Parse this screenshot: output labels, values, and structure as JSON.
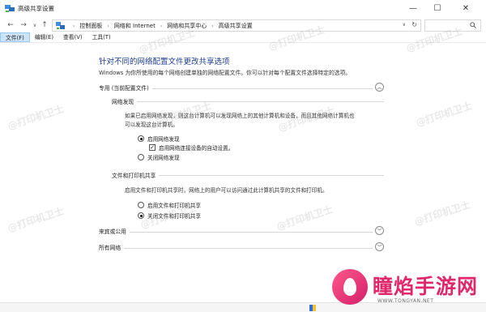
{
  "window": {
    "title": "高级共享设置",
    "minimize": "—",
    "maximize": "☐",
    "close": "✕"
  },
  "nav": {
    "back": "←",
    "forward": "→",
    "recent": "∨",
    "up": "↑"
  },
  "address": {
    "crumbs": [
      "控制面板",
      "网络和 Internet",
      "网络和共享中心",
      "高级共享设置"
    ],
    "separator": "›",
    "dropdown": "∨",
    "refresh": "↻"
  },
  "menu": {
    "items": [
      {
        "label": "文件(F)"
      },
      {
        "label": "编辑(E)"
      },
      {
        "label": "查看(V)"
      },
      {
        "label": "工具(T)"
      }
    ]
  },
  "page": {
    "heading": "针对不同的网络配置文件更改共享选项",
    "subtitle": "Windows 为你所使用的每个网络创建单独的网络配置文件。你可以针对每个配置文件选择特定的选项。"
  },
  "profiles": {
    "private_label": "专用 (当前配置文件)",
    "private_chevron": "︿",
    "guest_label": "来宾或公用",
    "guest_chevron": "﹀",
    "all_label": "所有网络",
    "all_chevron": "﹀"
  },
  "discovery": {
    "heading": "网络发现",
    "desc_line1": "如果已启用网络发现，则这台计算机可以发现网络上的其他计算机和设备，而且其他网络计算机也",
    "desc_line2": "可以发现这台计算机。",
    "on_label": "启用网络发现",
    "on_selected": true,
    "auto_label": "启用网络连接设备的自动设置。",
    "auto_checked": true,
    "check_mark": "✓",
    "off_label": "关闭网络发现",
    "off_selected": false
  },
  "filesharing": {
    "heading": "文件和打印机共享",
    "desc": "启用文件和打印机共享时，网络上的用户可以访问通过此计算机共享的文件和打印机。",
    "on_label": "启用文件和打印机共享",
    "on_selected": false,
    "off_label": "关闭文件和打印机共享",
    "off_selected": true
  },
  "watermark": {
    "text": "@打印机卫士"
  },
  "brand": {
    "name": "瞳焰手游网",
    "url": "WWW.TONGYAN.NET"
  }
}
